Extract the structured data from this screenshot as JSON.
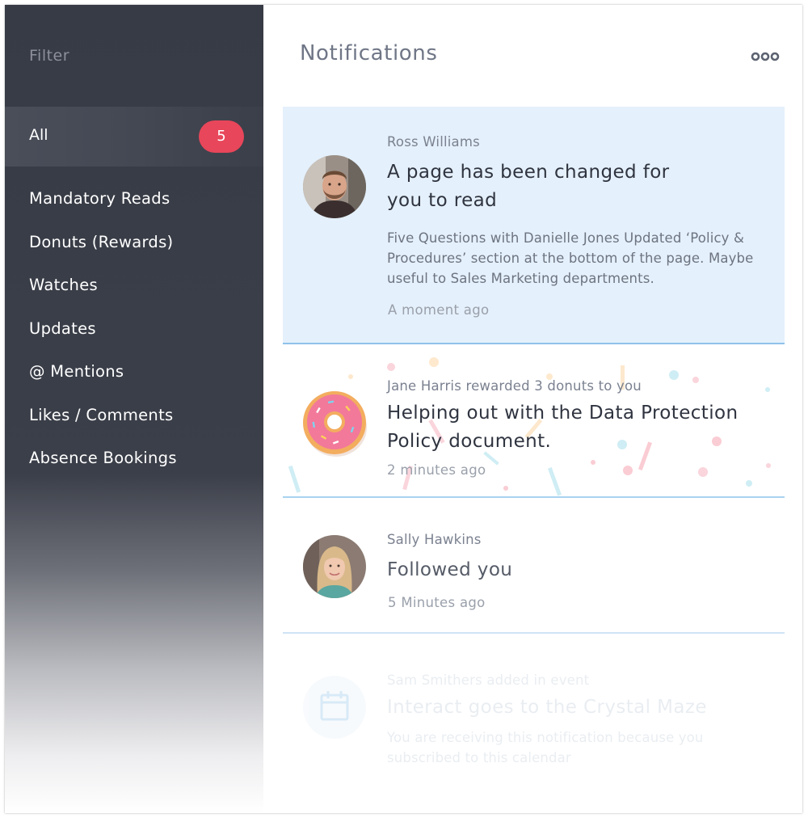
{
  "sidebar": {
    "filter_title": "Filter",
    "all_label": "All",
    "all_count": "5",
    "items": [
      {
        "label": "Mandatory Reads"
      },
      {
        "label": "Donuts (Rewards)"
      },
      {
        "label": "Watches"
      },
      {
        "label": "Updates"
      },
      {
        "label": "@ Mentions"
      },
      {
        "label": "Likes / Comments"
      },
      {
        "label": "Absence Bookings"
      }
    ]
  },
  "header": {
    "title": "Notifications",
    "more_icon": "more-horizontal-icon"
  },
  "notifications": [
    {
      "actor": "Ross Williams",
      "headline_line1": "A page has been changed for",
      "headline_line2": "you to read",
      "body": "Five Questions with Danielle Jones Updated ‘Policy & Procedures’ section at the bottom of the page. Maybe useful to Sales Marketing departments.",
      "time": "A moment ago",
      "icon": "avatar-photo"
    },
    {
      "actor": "Jane Harris rewarded 3 donuts to you",
      "headline_line1": "Helping out with the Data Protection",
      "headline_line2": "Policy document.",
      "time": "2 minutes ago",
      "icon": "donut-icon"
    },
    {
      "actor": "Sally Hawkins",
      "headline_line1": "Followed you",
      "time": "5 Minutes ago",
      "icon": "avatar-photo"
    },
    {
      "actor": "Sam Smithers added in event",
      "headline_line1": "Interact goes to the Crystal Maze",
      "body": "You are receiving this notification because you subscribed to this calendar",
      "icon": "calendar-icon"
    }
  ],
  "colors": {
    "sidebar_bg": "#373b45",
    "badge": "#e8465a",
    "highlight_card": "#e4f0fb",
    "divider": "#a9d3f0"
  }
}
